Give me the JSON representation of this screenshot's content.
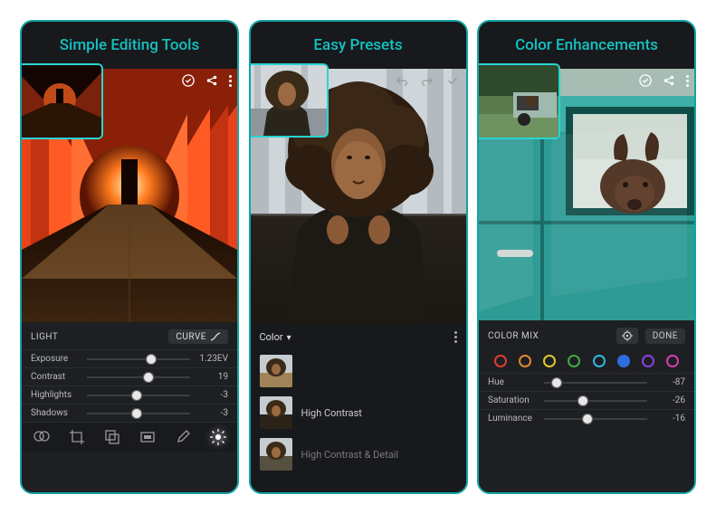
{
  "panels": [
    {
      "title": "Simple Editing Tools",
      "section_label": "LIGHT",
      "curve_label": "CURVE",
      "sliders": [
        {
          "label": "Exposure",
          "value": "1.23EV",
          "knob_pct": 62
        },
        {
          "label": "Contrast",
          "value": "19",
          "knob_pct": 60
        },
        {
          "label": "Highlights",
          "value": "-3",
          "knob_pct": 48
        },
        {
          "label": "Shadows",
          "value": "-3",
          "knob_pct": 48
        }
      ],
      "bottom_icons": [
        "filters",
        "crop",
        "stack",
        "frame",
        "dropper",
        "light"
      ]
    },
    {
      "title": "Easy Presets",
      "group_label": "Color",
      "presets": [
        {
          "label": "",
          "dim": false
        },
        {
          "label": "High Contrast",
          "dim": false
        },
        {
          "label": "High Contrast & Detail",
          "dim": true
        }
      ]
    },
    {
      "title": "Color Enhancements",
      "section_label": "COLOR MIX",
      "done_label": "DONE",
      "colors": [
        "#e03c2f",
        "#e0892f",
        "#e0c72f",
        "#3fae3f",
        "#2fb8e0",
        "#2f6de0",
        "#8a3fe0",
        "#d23fae"
      ],
      "selected_color_index": 5,
      "sliders": [
        {
          "label": "Hue",
          "value": "-87",
          "knob_pct": 12
        },
        {
          "label": "Saturation",
          "value": "-26",
          "knob_pct": 38
        },
        {
          "label": "Luminance",
          "value": "-16",
          "knob_pct": 42
        }
      ]
    }
  ]
}
